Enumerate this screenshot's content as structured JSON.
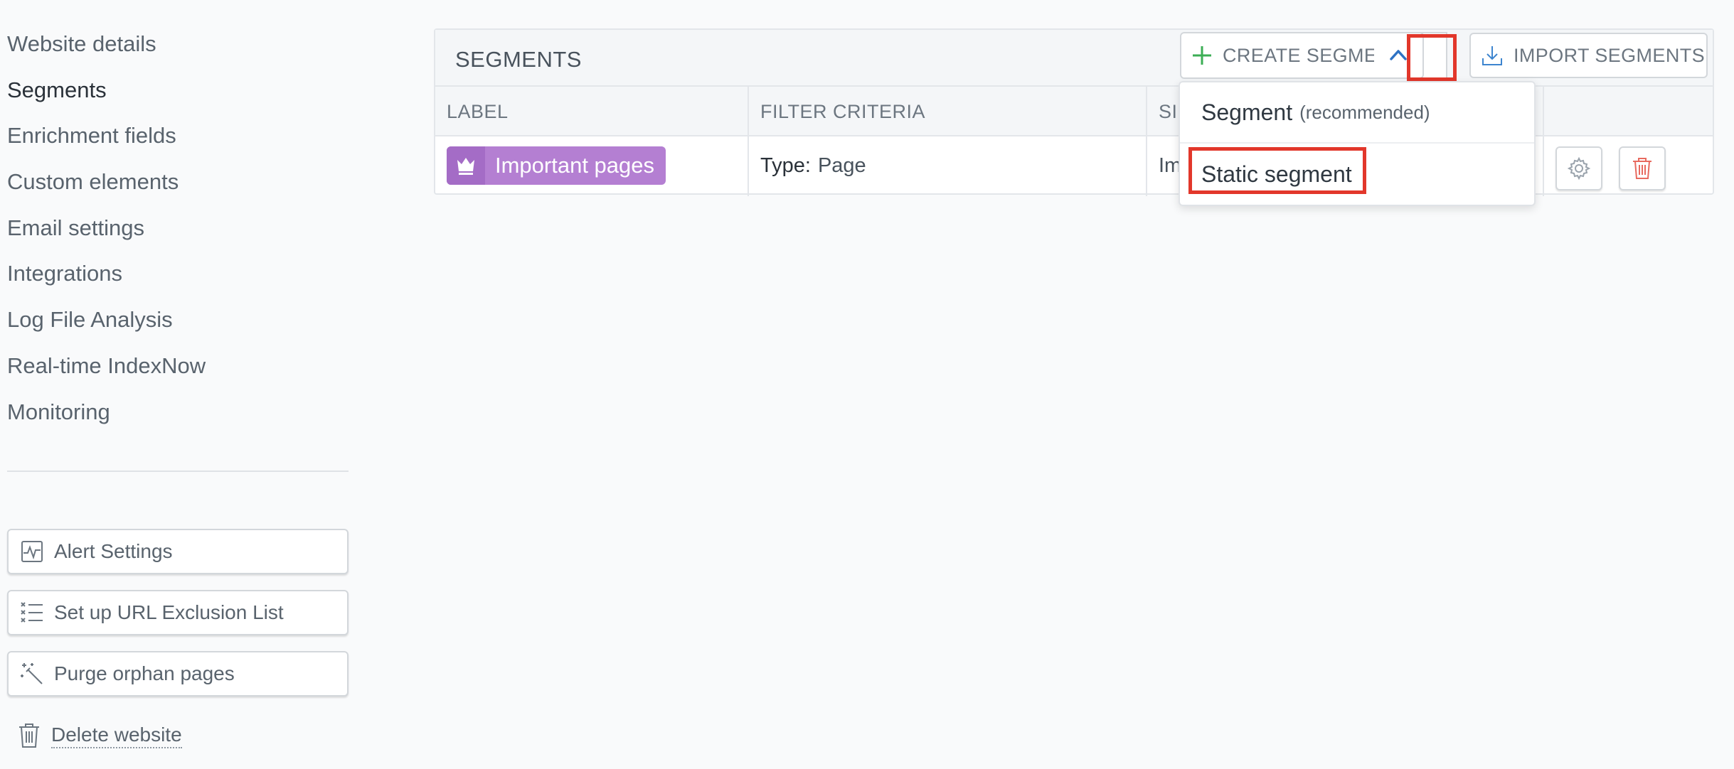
{
  "sidebar": {
    "nav": [
      {
        "label": "Website details",
        "active": false
      },
      {
        "label": "Segments",
        "active": true
      },
      {
        "label": "Enrichment fields",
        "active": false
      },
      {
        "label": "Custom elements",
        "active": false
      },
      {
        "label": "Email settings",
        "active": false
      },
      {
        "label": "Integrations",
        "active": false
      },
      {
        "label": "Log File Analysis",
        "active": false
      },
      {
        "label": "Real-time IndexNow",
        "active": false
      },
      {
        "label": "Monitoring",
        "active": false
      }
    ],
    "buttons": [
      {
        "label": "Alert Settings",
        "icon": "activity-chart-icon"
      },
      {
        "label": "Set up URL Exclusion List",
        "icon": "exclusion-list-icon"
      },
      {
        "label": "Purge orphan pages",
        "icon": "magic-wand-icon"
      }
    ],
    "delete_website": {
      "label": "Delete website",
      "icon": "trash-icon"
    }
  },
  "segments_panel": {
    "title": "SEGMENTS",
    "create_button": {
      "label": "CREATE SEGMENT",
      "icon": "plus-icon",
      "accent": "#3cae55"
    },
    "caret_button": {
      "icon": "chevron-up-icon",
      "accent": "#2e72c4"
    },
    "import_button": {
      "label": "IMPORT SEGMENTS",
      "icon": "download-icon"
    },
    "columns": [
      "LABEL",
      "FILTER CRITERIA",
      "SI"
    ],
    "rows": [
      {
        "label": "Important pages",
        "label_icon": "crown-icon",
        "label_color": "#b47fd2",
        "filter_key": "Type:",
        "filter_value": "Page",
        "size_text": "Im"
      }
    ],
    "row_actions": [
      {
        "icon": "gear-icon"
      },
      {
        "icon": "trash-icon",
        "color": "#e86a5f"
      }
    ]
  },
  "dropdown": {
    "items": [
      {
        "label": "Segment",
        "note": "(recommended)"
      },
      {
        "label": "Static segment",
        "highlighted": true
      }
    ]
  },
  "highlight_color": "#e2372b"
}
